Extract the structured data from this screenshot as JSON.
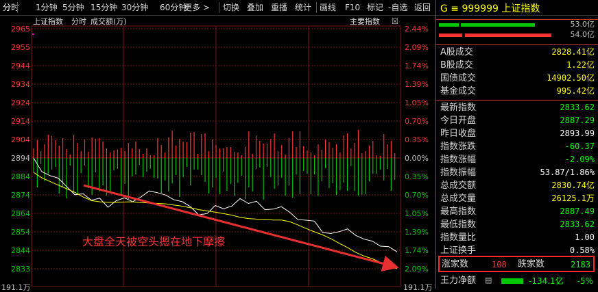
{
  "toolbar": {
    "items": [
      "分时",
      "1分钟",
      "5分钟",
      "15分钟",
      "30分钟",
      "60分钟",
      "更多 >",
      "切换",
      "叠加",
      "重播",
      "统计",
      "画线",
      "F10",
      "标记",
      "-自选",
      "返回"
    ]
  },
  "chart": {
    "title": "上证指数",
    "mode": "分时",
    "sub_label": "成交额(万)",
    "main_indicator": "主要指数",
    "price_ticks": [
      "2965",
      "2955",
      "2944",
      "2934",
      "2924",
      "2914",
      "2904",
      "2894",
      "2884",
      "2874",
      "2864",
      "2854",
      "2844",
      "2833"
    ],
    "pct_ticks": [
      "2.44%",
      "2.09%",
      "1.74%",
      "1.39%",
      "1.05%",
      "0.70%",
      "0.35%",
      "0.00%",
      "0.35%",
      "0.70%",
      "1.05%",
      "1.39%",
      "1.74%",
      "2.09%"
    ],
    "bottom_left": "191.1万",
    "bottom_right": "191.1万",
    "annotation": "大盘全天被空头摁在地下摩擦",
    "colors": {
      "up": "#ff3232",
      "down": "#00c800",
      "price_line": "#ffffff",
      "avg_line": "#ffff00",
      "arrow": "#e83030",
      "grid": "#7a1a1a"
    }
  },
  "chart_data": {
    "type": "line",
    "title": "上证指数",
    "prev_close": 2893.99,
    "ylim": [
      2833,
      2965
    ],
    "series": [
      {
        "values": [
          2893.9,
          2886.4,
          2884.2,
          2882.8,
          2878.2,
          2873.7,
          2874.2,
          2870.7,
          2871.8,
          2866.8,
          2870.4,
          2872.0,
          2869.9,
          2872.5,
          2875.8,
          2874.8,
          2873.5,
          2870.9,
          2869.9,
          2867.1,
          2862.6,
          2863.4,
          2867.8,
          2866.0,
          2867.5,
          2871.6,
          2868.9,
          2870.1,
          2865.5,
          2865.8,
          2867.1,
          2864.1,
          2860.0,
          2859.7,
          2859.2,
          2852.9,
          2852.4,
          2853.4,
          2854.9,
          2851.3,
          2849.3,
          2848.2,
          2845.4,
          2845.1,
          2842.3
        ]
      },
      {
        "values": [
          2886.0,
          2883.0,
          2881.0,
          2879.0,
          2877.0,
          2875.0,
          2872.5,
          2870.5,
          2869.8,
          2869.5,
          2869.5,
          2869.7,
          2869.8,
          2869.4,
          2869.2,
          2868.9,
          2868.7,
          2868.0,
          2867.4,
          2866.5,
          2865.5,
          2864.9,
          2864.1,
          2863.3,
          2862.5,
          2861.3,
          2860.6,
          2860.3,
          2860.1,
          2859.8,
          2859.8,
          2858.9,
          2857.1,
          2855.1,
          2853.3,
          2851.6,
          2849.5,
          2847.0,
          2844.7,
          2842.0,
          2840.0,
          2838.5,
          2836.5,
          2834.5,
          2833.0
        ]
      }
    ],
    "volume": {
      "up": [
        14,
        26,
        10,
        20,
        34,
        32,
        26,
        18,
        29,
        13,
        5,
        34,
        22,
        10,
        27,
        9,
        30,
        28,
        29,
        24,
        14,
        8,
        11,
        12,
        15,
        10,
        22,
        14,
        24,
        13,
        6,
        14,
        4,
        4,
        29,
        19,
        8,
        30,
        40,
        18,
        28,
        24,
        23,
        37,
        38,
        6,
        35,
        36,
        10,
        27,
        19,
        14,
        14,
        16,
        16,
        9,
        8,
        4,
        16,
        39,
        6,
        33,
        25,
        21,
        21,
        28,
        36,
        10,
        19,
        5,
        29,
        39,
        16,
        39,
        17,
        11,
        8,
        4,
        20,
        12,
        27,
        23,
        15,
        20,
        8,
        33,
        36,
        14,
        22,
        41,
        7,
        10,
        18,
        25,
        4,
        3,
        35,
        20,
        25,
        7
      ],
      "down": [
        20,
        43,
        9,
        34,
        23,
        17,
        13,
        52,
        43,
        59,
        11,
        52,
        52,
        22,
        11,
        44,
        54,
        21,
        49,
        40,
        55,
        49,
        18,
        16,
        55,
        38,
        60,
        27,
        24,
        10,
        28,
        20,
        16,
        29,
        30,
        51,
        33,
        49,
        37,
        25,
        57,
        28,
        13,
        40,
        17,
        17,
        25,
        35,
        52,
        43,
        29,
        53,
        20,
        48,
        38,
        55,
        36,
        26,
        60,
        43,
        49,
        16,
        14,
        61,
        13,
        28,
        45,
        40,
        29,
        55,
        40,
        58,
        24,
        53,
        19,
        23,
        53,
        24,
        55,
        34,
        15,
        44,
        37,
        54,
        47,
        36,
        48,
        12,
        48,
        55,
        54,
        53,
        34,
        23,
        23,
        17,
        33,
        16,
        48,
        32
      ]
    }
  },
  "panel": {
    "header_code": "G ≡ 999999",
    "header_name": "上证指数",
    "bars": [
      {
        "label": "53.0亿",
        "frac": 0.6
      },
      {
        "label": "54.0亿",
        "frac": 0.7
      }
    ],
    "group1": [
      {
        "k": "A股成交",
        "v": "2828.41亿",
        "c": "#ffff00"
      },
      {
        "k": "B股成交",
        "v": "1.22亿",
        "c": "#ffff00"
      },
      {
        "k": "国债成交",
        "v": "14902.50亿",
        "c": "#ffff00"
      },
      {
        "k": "基金成交",
        "v": "995.42亿",
        "c": "#ffff00"
      }
    ],
    "group2": [
      {
        "k": "最新指数",
        "v": "2833.62",
        "c": "#00ff00"
      },
      {
        "k": "今日开盘",
        "v": "2887.29",
        "c": "#00ff00"
      },
      {
        "k": "昨日收盘",
        "v": "2893.99",
        "c": "#ffffff"
      },
      {
        "k": "指数涨跌",
        "v": "-60.37",
        "c": "#00ff00"
      },
      {
        "k": "指数涨幅",
        "v": "-2.09%",
        "c": "#00ff00"
      },
      {
        "k": "指数振幅",
        "v": "53.87/1.86%",
        "c": "#ffffff"
      },
      {
        "k": "总成交额",
        "v": "2830.74亿",
        "c": "#ffff00"
      },
      {
        "k": "总成交量",
        "v": "26125.1万",
        "c": "#ffff00"
      },
      {
        "k": "最高指数",
        "v": "2887.49",
        "c": "#00ff00"
      },
      {
        "k": "最低指数",
        "v": "2833.62",
        "c": "#00ff00"
      },
      {
        "k": "指数量比",
        "v": "1.00",
        "c": "#ffffff"
      },
      {
        "k": "上证换手",
        "v": "0.58%",
        "c": "#ffffff"
      }
    ],
    "breadth": {
      "up_label": "涨家数",
      "up_value": "108",
      "down_label": "跌家数",
      "down_value": "2183"
    },
    "mainforce": {
      "label": "王力净额",
      "value": "-134.1亿",
      "pct": "-5%"
    }
  }
}
